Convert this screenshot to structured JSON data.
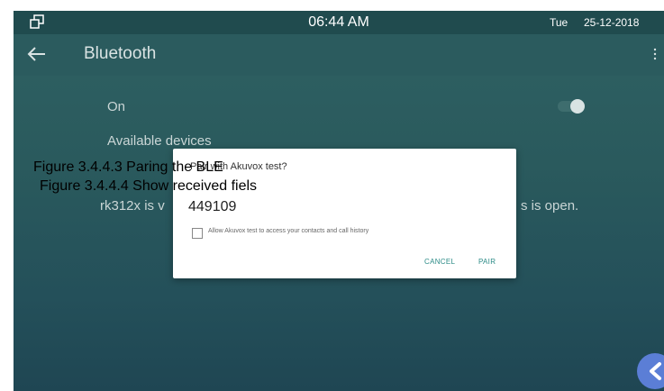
{
  "status_bar": {
    "time": "06:44 AM",
    "day": "Tue",
    "date": "25-12-2018",
    "left_icon": "window-restore-icon"
  },
  "app_bar": {
    "back_icon": "back-arrow-icon",
    "title": "Bluetooth",
    "menu_icon": "overflow-menu-icon"
  },
  "settings": {
    "on_label": "On",
    "toggle_on": true,
    "available_devices_label": "Available devices",
    "visibility_left": "rk312x is v",
    "visibility_right": "s is open."
  },
  "pair_dialog": {
    "title": "Pair with Akuvox test?",
    "code": "449109",
    "checkbox_label": "Allow Akuvox test to access your contacts and call history",
    "checkbox_checked": false,
    "cancel_label": "CANCEL",
    "pair_label": "PAIR",
    "accent_color": "#2c8b87"
  },
  "fab": {
    "icon": "chevron-left-icon",
    "color": "#5b7ed6"
  },
  "captions": {
    "caption1": "Figure 3.4.4.3 Paring the BLE",
    "caption2": "Figure 3.4.4.4 Show received fiels"
  }
}
